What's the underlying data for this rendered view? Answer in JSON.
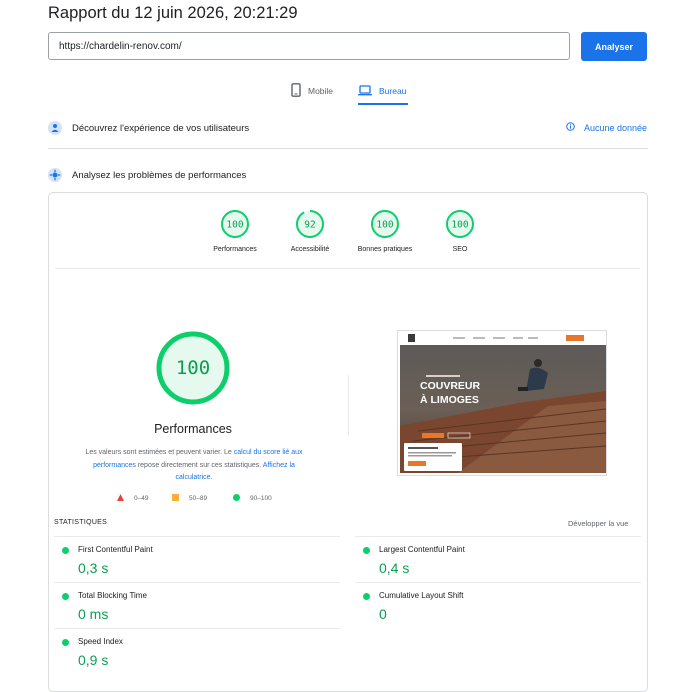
{
  "report": {
    "title": "Rapport du 12 juin 2026, 20:21:29",
    "url_value": "https://chardelin-renov.com/",
    "analyze_label": "Analyser"
  },
  "tabs": [
    {
      "label": "Mobile",
      "icon": "smartphone-icon",
      "active": false
    },
    {
      "label": "Bureau",
      "icon": "laptop-icon",
      "active": true
    }
  ],
  "sections": {
    "experience": {
      "label": "Découvrez l'expérience de vos utilisateurs",
      "no_data": "Aucune donnée"
    },
    "performance": {
      "label": "Analysez les problèmes de performances"
    }
  },
  "gauges": [
    {
      "score": "100",
      "label": "Performances"
    },
    {
      "score": "92",
      "label": "Accessibilité"
    },
    {
      "score": "100",
      "label": "Bonnes pratiques"
    },
    {
      "score": "100",
      "label": "SEO"
    }
  ],
  "main_gauge": {
    "score": "100",
    "title": "Performances",
    "desc_1": "Les valeurs sont estimées et peuvent varier. Le ",
    "desc_link_1": "calcul du score lié aux performances",
    "desc_2": " repose directement sur ces statistiques. ",
    "desc_link_2": "Affichez la calculatrice."
  },
  "legend": [
    {
      "range": "0–49",
      "color": "#e8403c",
      "shape": "triangle"
    },
    {
      "range": "50–89",
      "color": "#fbae3c",
      "shape": "square"
    },
    {
      "range": "90–100",
      "color": "#0cce6b",
      "shape": "circle"
    }
  ],
  "stats": {
    "label": "STATISTIQUES",
    "expand": "Développer la vue",
    "metrics": [
      {
        "name": "First Contentful Paint",
        "value": "0,3 s"
      },
      {
        "name": "Largest Contentful Paint",
        "value": "0,4 s"
      },
      {
        "name": "Total Blocking Time",
        "value": "0 ms"
      },
      {
        "name": "Cumulative Layout Shift",
        "value": "0"
      },
      {
        "name": "Speed Index",
        "value": "0,9 s"
      }
    ]
  },
  "thumbnail": {
    "headline_1": "COUVREUR",
    "headline_2": "À LIMOGES"
  },
  "colors": {
    "accent": "#1a73e8",
    "pass": "#0cce6b",
    "pass_text": "#0c9e50",
    "pass_bg": "#e6f9ef"
  }
}
